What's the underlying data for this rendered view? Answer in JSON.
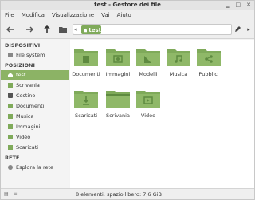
{
  "window": {
    "title": "test - Gestore dei file"
  },
  "menu": [
    "File",
    "Modifica",
    "Visualizzazione",
    "Vai",
    "Aiuto"
  ],
  "toolbar": {
    "crumb": "test"
  },
  "sidebar": {
    "sections": [
      {
        "title": "DISPOSITIVI",
        "items": [
          {
            "label": "File system",
            "icon": "drive-icon"
          }
        ]
      },
      {
        "title": "POSIZIONI",
        "items": [
          {
            "label": "test",
            "icon": "home-icon",
            "active": true
          },
          {
            "label": "Scrivania",
            "icon": "desktop-icon"
          },
          {
            "label": "Cestino",
            "icon": "trash-icon"
          },
          {
            "label": "Documenti",
            "icon": "folder-icon"
          },
          {
            "label": "Musica",
            "icon": "folder-icon"
          },
          {
            "label": "Immagini",
            "icon": "folder-icon"
          },
          {
            "label": "Video",
            "icon": "folder-icon"
          },
          {
            "label": "Scaricati",
            "icon": "folder-icon"
          }
        ]
      },
      {
        "title": "RETE",
        "items": [
          {
            "label": "Esplora la rete",
            "icon": "network-icon"
          }
        ]
      }
    ]
  },
  "folders": [
    {
      "label": "Documenti",
      "icon": "documents-folder-icon"
    },
    {
      "label": "Immagini",
      "icon": "pictures-folder-icon"
    },
    {
      "label": "Modelli",
      "icon": "templates-folder-icon"
    },
    {
      "label": "Musica",
      "icon": "music-folder-icon"
    },
    {
      "label": "Pubblici",
      "icon": "public-folder-icon"
    },
    {
      "label": "Scaricati",
      "icon": "downloads-folder-icon"
    },
    {
      "label": "Scrivania",
      "icon": "desktop-folder-icon"
    },
    {
      "label": "Video",
      "icon": "videos-folder-icon"
    }
  ],
  "status": "8 elementi, spazio libero: 7,6 GiB",
  "colors": {
    "accent": "#8cb365",
    "folder": "#7faa5a",
    "folder_dark": "#5e8a40"
  }
}
